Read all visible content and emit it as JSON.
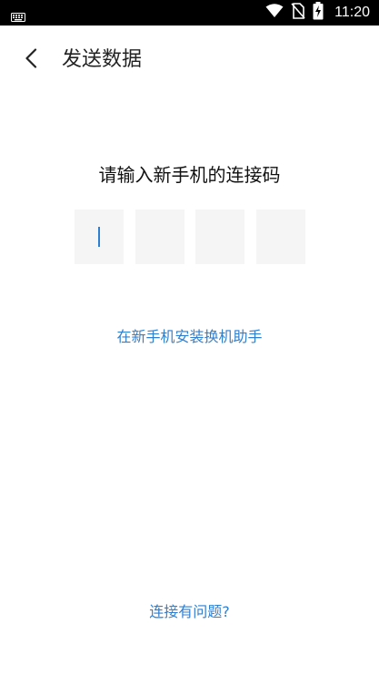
{
  "status_bar": {
    "time": "11:20",
    "icons": [
      "keyboard-icon",
      "wifi-icon",
      "no-sim-icon",
      "battery-charging-icon"
    ]
  },
  "header": {
    "back_icon": "chevron-left-icon",
    "title": "发送数据"
  },
  "main": {
    "prompt": "请输入新手机的连接码",
    "code_boxes": [
      "",
      "",
      "",
      ""
    ],
    "focused_box": 0,
    "install_link": "在新手机安装换机助手"
  },
  "footer": {
    "help_link": "连接有问题?"
  },
  "colors": {
    "accent": "#2f7fd0",
    "box_background": "#f5f5f5",
    "status_bar": "#000000"
  }
}
